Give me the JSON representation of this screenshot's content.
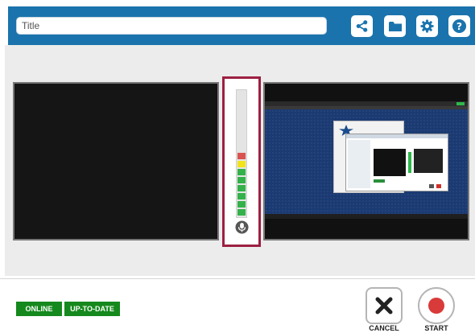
{
  "header": {
    "title_placeholder": "Title",
    "title_value": "",
    "buttons": [
      {
        "name": "share",
        "icon": "share-icon"
      },
      {
        "name": "folder",
        "icon": "folder-icon"
      },
      {
        "name": "settings",
        "icon": "gear-icon"
      },
      {
        "name": "help",
        "icon": "help-icon"
      }
    ]
  },
  "audio_meter": {
    "level_segments_lit": 8,
    "segments": [
      {
        "color": "#d9534f"
      },
      {
        "color": "#f2e31b"
      },
      {
        "color": "#33b24a"
      },
      {
        "color": "#33b24a"
      },
      {
        "color": "#33b24a"
      },
      {
        "color": "#33b24a"
      },
      {
        "color": "#33b24a"
      },
      {
        "color": "#33b24a"
      }
    ],
    "icon": "microphone-icon"
  },
  "status": {
    "online": "ONLINE",
    "uptodate": "UP-TO-DATE"
  },
  "actions": {
    "cancel_label": "CANCEL",
    "start_label": "START"
  },
  "colors": {
    "header": "#1a73ad",
    "meter_border": "#9c2041",
    "badge": "#15891d",
    "record": "#d93a3a"
  }
}
